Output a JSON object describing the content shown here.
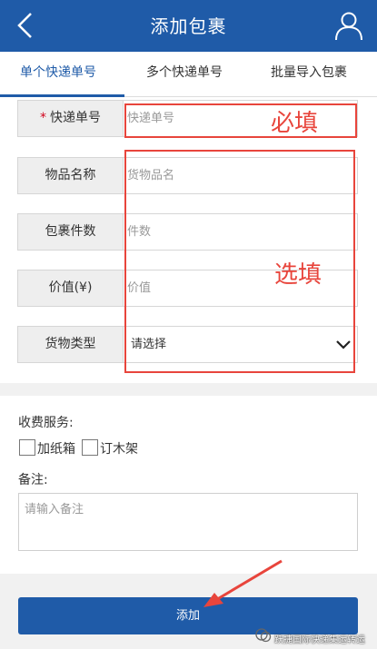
{
  "header": {
    "title": "添加包裹"
  },
  "tabs": [
    {
      "label": "单个快递单号",
      "active": true
    },
    {
      "label": "多个快递单号",
      "active": false
    },
    {
      "label": "批量导入包裹",
      "active": false
    }
  ],
  "form": {
    "tracking": {
      "required_mark": "*",
      "label": "快递单号",
      "placeholder": "快递单号"
    },
    "item_name": {
      "label": "物品名称",
      "placeholder": "货物品名"
    },
    "count": {
      "label": "包裹件数",
      "placeholder": "件数"
    },
    "value": {
      "label": "价值(¥)",
      "placeholder": "价值"
    },
    "type": {
      "label": "货物类型",
      "selected": "请选择"
    }
  },
  "annotations": {
    "required": "必填",
    "optional": "选填"
  },
  "services": {
    "label": "收费服务:",
    "options": [
      {
        "label": "加纸箱",
        "checked": false
      },
      {
        "label": "订木架",
        "checked": false
      }
    ]
  },
  "note": {
    "label": "备注:",
    "placeholder": "请输入备注"
  },
  "submit": {
    "label": "添加"
  },
  "watermark": {
    "text": "跃捷国际快递集运转运"
  },
  "colors": {
    "primary": "#1f5ba8",
    "annotation": "#e8453c"
  }
}
